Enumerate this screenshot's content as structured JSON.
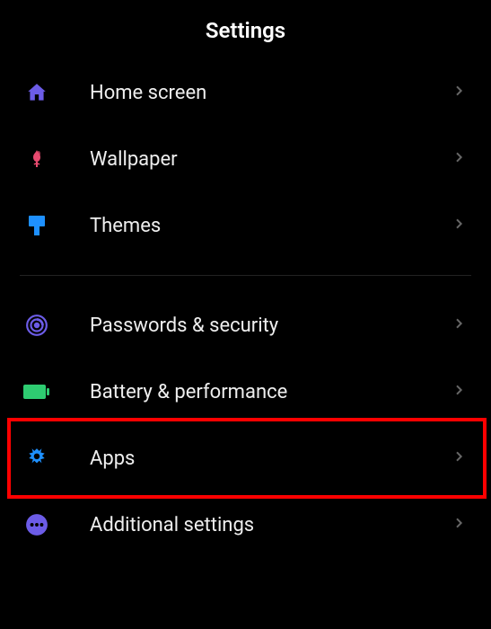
{
  "header": {
    "title": "Settings"
  },
  "groups": [
    {
      "items": [
        {
          "icon": "home-icon",
          "label": "Home screen"
        },
        {
          "icon": "wallpaper-icon",
          "label": "Wallpaper"
        },
        {
          "icon": "themes-icon",
          "label": "Themes"
        }
      ]
    },
    {
      "items": [
        {
          "icon": "passwords-icon",
          "label": "Passwords & security"
        },
        {
          "icon": "battery-icon",
          "label": "Battery & performance"
        },
        {
          "icon": "apps-icon",
          "label": "Apps",
          "highlighted": true
        },
        {
          "icon": "additional-icon",
          "label": "Additional settings"
        }
      ]
    }
  ],
  "colors": {
    "home": "#6c5ce7",
    "wallpaper": "#e84a6f",
    "themes": "#1e90ff",
    "passwords": "#6c5ce7",
    "battery": "#2ecc71",
    "apps": "#1e90ff",
    "additional": "#6c5ce7"
  }
}
